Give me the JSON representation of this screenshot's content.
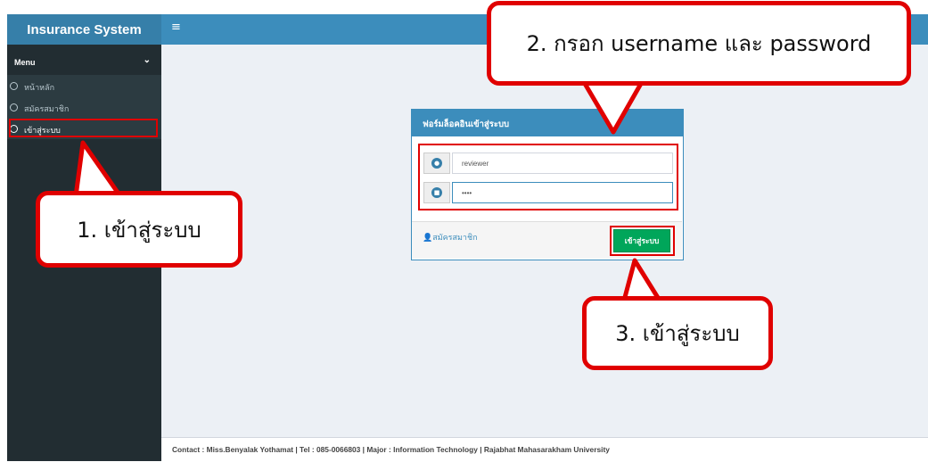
{
  "app": {
    "title": "Insurance System",
    "menu_icon": "hamburger-icon"
  },
  "sidebar": {
    "header": "Menu",
    "items": [
      {
        "label": "หน้าหลัก"
      },
      {
        "label": "สมัครสมาชิก"
      },
      {
        "label": "เข้าสู่ระบบ"
      }
    ]
  },
  "login_panel": {
    "title": "ฟอร์มล็อคอินเข้าสู่ระบบ",
    "username_value": "reviewer",
    "password_value": "••••",
    "register_link": "สมัครสมาชิก",
    "login_button": "เข้าสู่ระบบ"
  },
  "callouts": {
    "step1": "1. เข้าสู่ระบบ",
    "step2": "2. กรอก username และ password",
    "step3": "3. เข้าสู่ระบบ"
  },
  "footer": {
    "text": "Contact : Miss.Benyalak Yothamat | Tel : 085-0066803 | Major : Information Technology | Rajabhat Mahasarakham University"
  },
  "colors": {
    "accent": "#3c8dbc",
    "sidebar": "#222d32",
    "button": "#00a65a",
    "highlight": "#e00000"
  }
}
